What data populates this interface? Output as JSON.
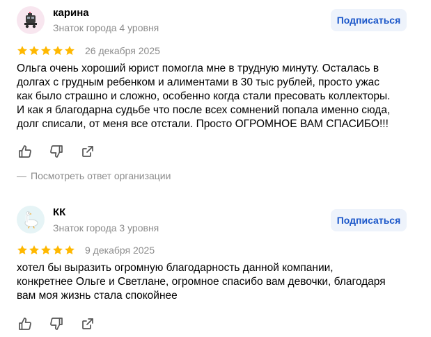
{
  "reviews": [
    {
      "author": "карина",
      "level": "Знаток города 4 уровня",
      "subscribe_label": "Подписаться",
      "rating": 5,
      "date": "26 декабря 2025",
      "text_lines": [
        "Ольга очень хороший юрист помогла мне в трудную минуту. Осталась в",
        "долгах с грудным ребенком и алиментами в 30 тыс рублей, просто ужас",
        "как было страшно и сложно, особенно когда стали пресовать коллекторы.",
        "И как я благодарна судьбе что после всех сомнений попала именно сюда,",
        "долг списали, от меня все отстали. Просто ОГРОМНОЕ ВАМ СПАСИБО!!!"
      ],
      "avatar_icon": "robot-cart-avatar-icon",
      "avatar_bg": "#f8e6ef",
      "reply_dash": "—",
      "reply_link": "Посмотреть ответ организации"
    },
    {
      "author": "КК",
      "level": "Знаток города 3 уровня",
      "subscribe_label": "Подписаться",
      "rating": 5,
      "date": "9 декабря 2025",
      "text_lines": [
        "хотел бы выразить огромную благодарность данной компании,",
        "конкретнее Ольге и Светлане, огромное спасибо вам девочки, благодаря",
        "вам моя жизнь стала спокойнее"
      ],
      "avatar_icon": "goose-avatar-icon",
      "avatar_bg": "#e6f4f6"
    }
  ],
  "colors": {
    "star": "#ffb800",
    "accent": "#1a56c9",
    "button_bg": "#eef3fb",
    "muted_text": "#8c8c8c",
    "icon": "#555555"
  },
  "icons": [
    "like-icon",
    "dislike-icon",
    "share-icon",
    "star-icon"
  ]
}
